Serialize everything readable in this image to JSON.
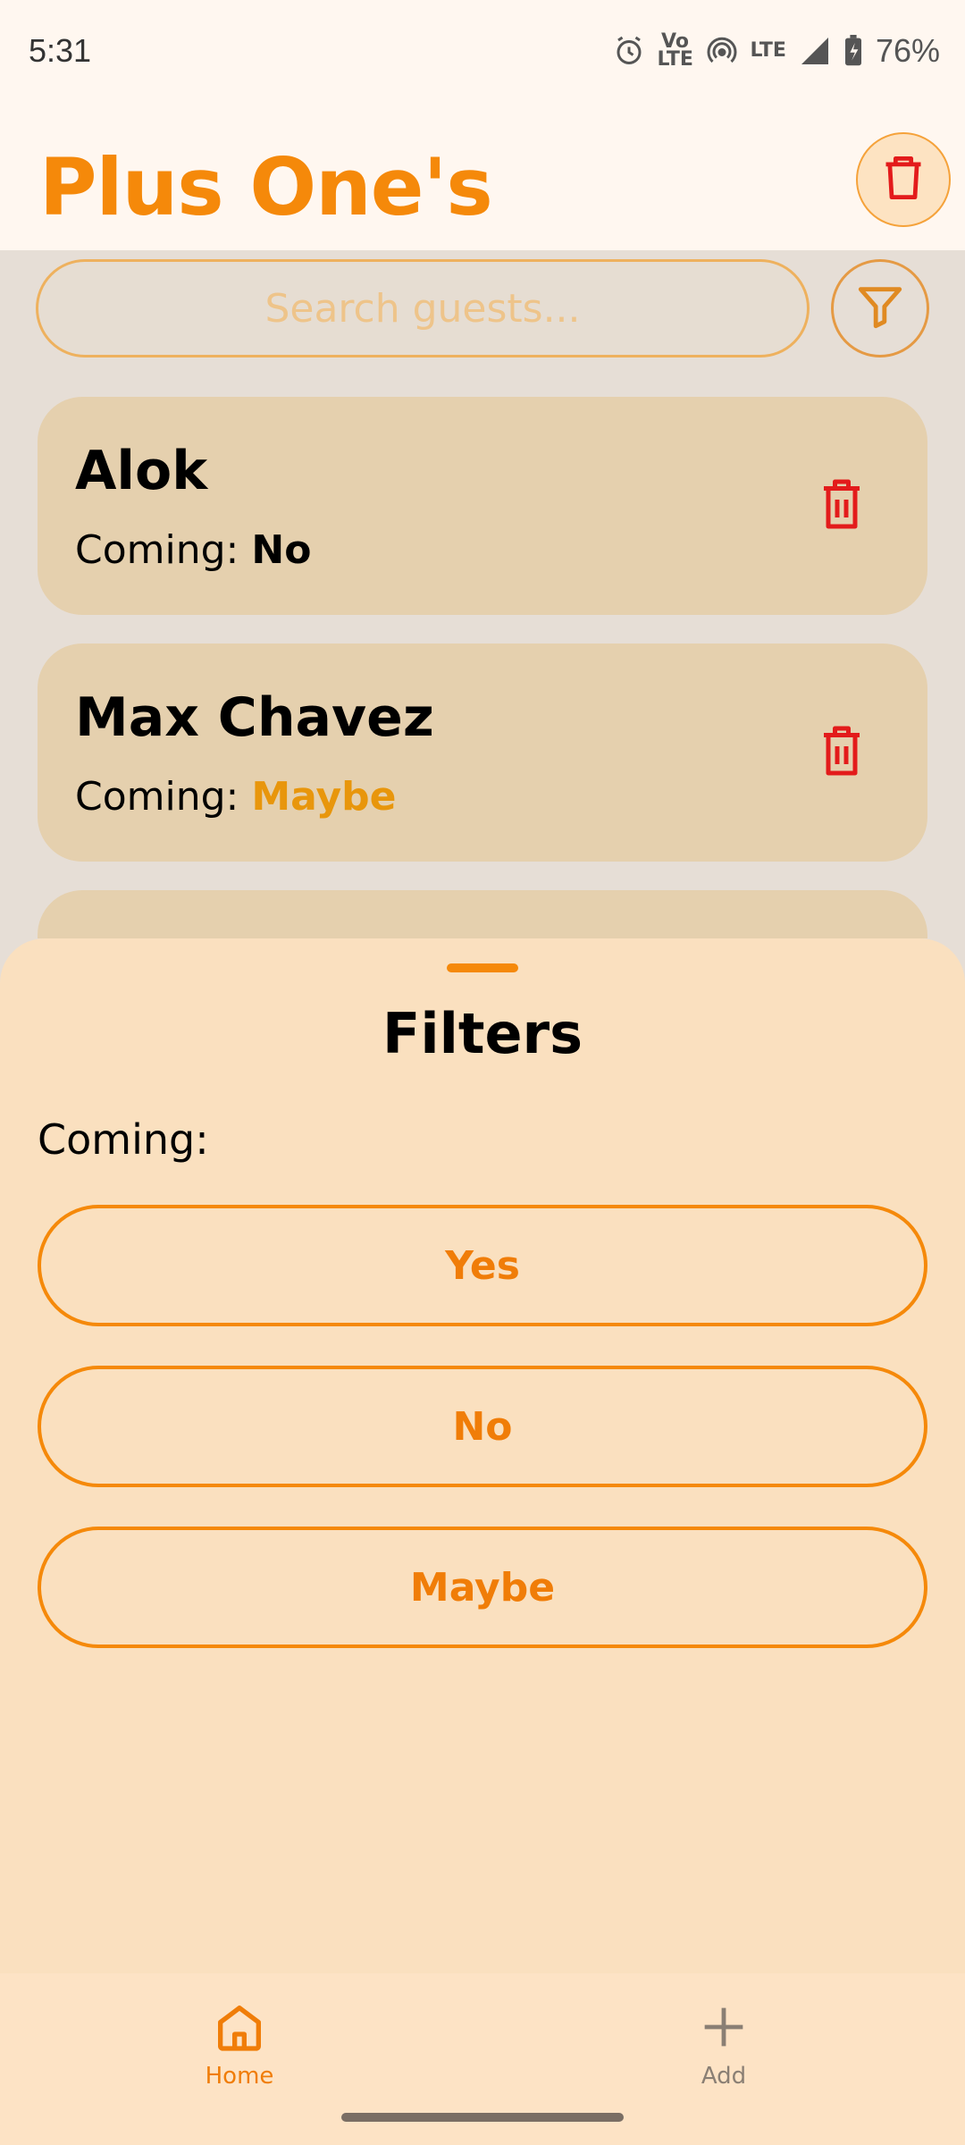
{
  "status_bar": {
    "time": "5:31",
    "volte_label": "Vo LTE",
    "lte_label": "LTE",
    "battery": "76%"
  },
  "header": {
    "title": "Plus One's"
  },
  "search": {
    "placeholder": "Search guests..."
  },
  "guests": [
    {
      "name": "Alok",
      "status_label": "Coming:",
      "status_value": "No",
      "status_color": "#000000"
    },
    {
      "name": "Max Chavez",
      "status_label": "Coming:",
      "status_value": "Maybe",
      "status_color": "#e8960c"
    }
  ],
  "filters_sheet": {
    "title": "Filters",
    "coming_label": "Coming:",
    "options": [
      "Yes",
      "No",
      "Maybe"
    ]
  },
  "bottom_nav": {
    "items": [
      {
        "label": "Home",
        "icon": "home-icon",
        "active": true
      },
      {
        "label": "Add",
        "icon": "plus-icon",
        "active": false
      }
    ]
  },
  "colors": {
    "accent": "#f5890a",
    "danger": "#e31b1b",
    "card": "#e5d0ae",
    "sheet": "#fae0bf"
  }
}
